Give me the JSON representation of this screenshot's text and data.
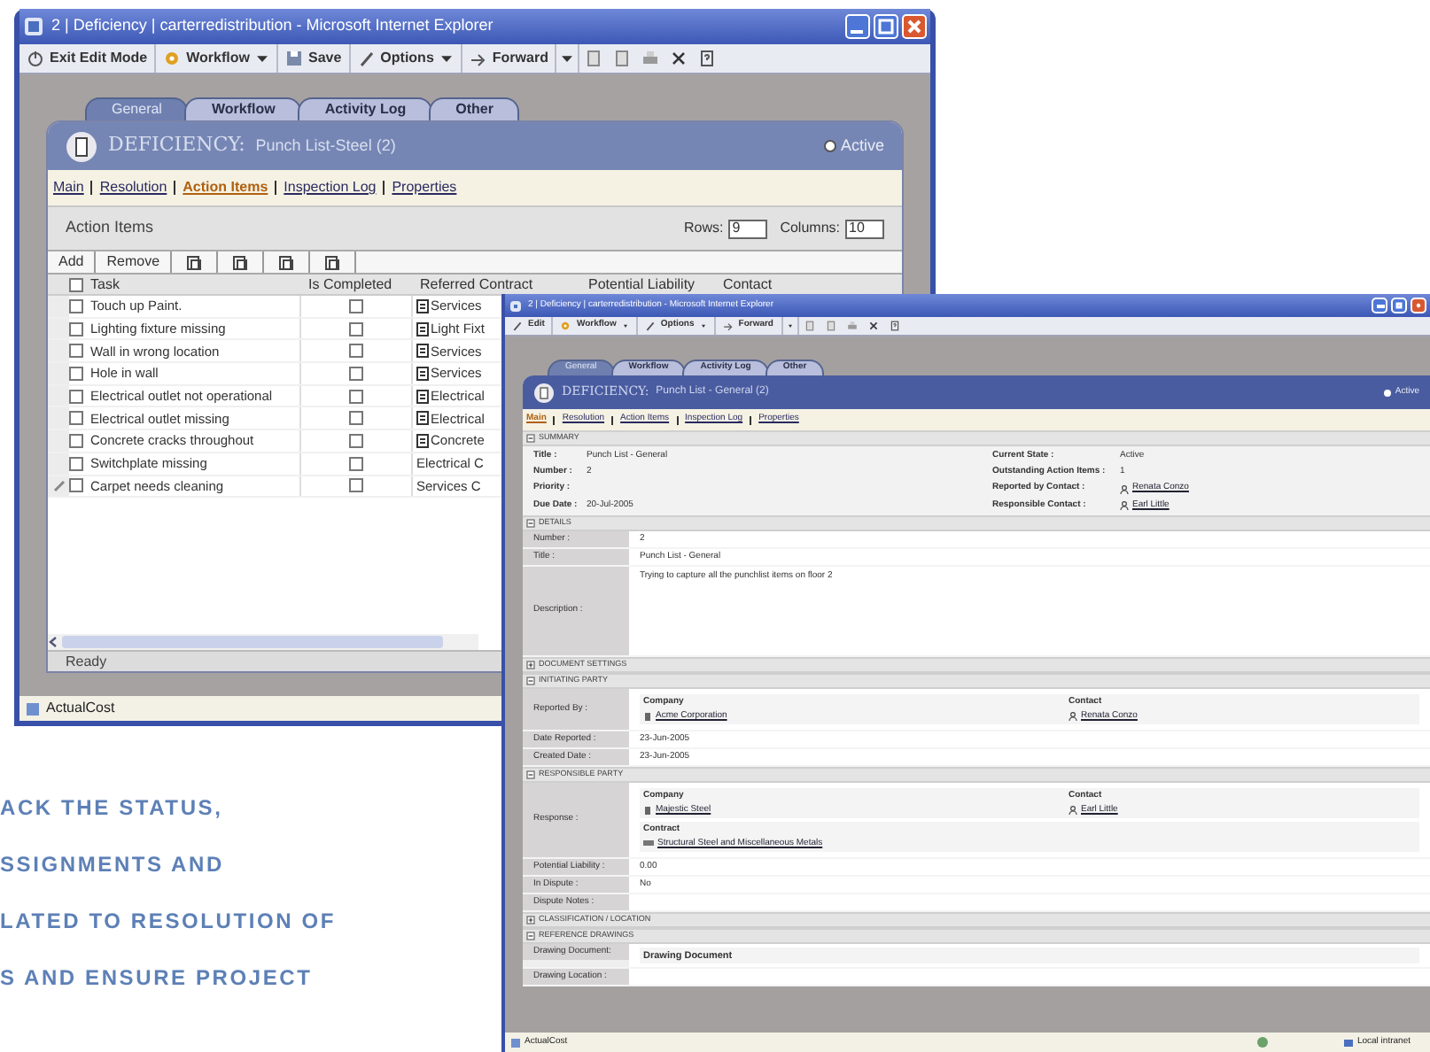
{
  "back_window": {
    "title": "2 | Deficiency | carterredistribution - Microsoft Internet Explorer",
    "toolbar": [
      {
        "label": "Exit Edit Mode",
        "kind": "button"
      },
      {
        "label": "Workflow",
        "kind": "menu"
      },
      {
        "label": "Save",
        "kind": "button"
      },
      {
        "label": "Options",
        "kind": "menu"
      },
      {
        "label": "Forward",
        "kind": "split"
      }
    ],
    "tabs": [
      {
        "label": "General",
        "selected": true
      },
      {
        "label": "Workflow",
        "selected": false
      },
      {
        "label": "Activity Log",
        "selected": false
      },
      {
        "label": "Other",
        "selected": false
      }
    ],
    "header": {
      "type_label": "DEFICIENCY:",
      "name": "Punch List-Steel (2)",
      "state": "Active"
    },
    "subnav": [
      {
        "label": "Main",
        "selected": false
      },
      {
        "label": "Resolution",
        "selected": false
      },
      {
        "label": "Action Items",
        "selected": true
      },
      {
        "label": "Inspection Log",
        "selected": false
      },
      {
        "label": "Properties",
        "selected": false
      }
    ],
    "panel_title": "Action Items",
    "rows_label": "Rows:",
    "rows_value": "9",
    "columns_label": "Columns:",
    "columns_value": "10",
    "grid_buttons": [
      "Add",
      "Remove"
    ],
    "select_all_checked": false,
    "columns": [
      "Task",
      "Is Completed",
      "Referred Contract",
      "Potential Liability",
      "Contact"
    ],
    "rows": [
      {
        "task": "Touch up Paint.",
        "selected": false,
        "completed": false,
        "contract": "Services",
        "document_icon": true,
        "editing": false
      },
      {
        "task": "Lighting fixture missing",
        "selected": false,
        "completed": false,
        "contract": "Light Fixt",
        "document_icon": true,
        "editing": false
      },
      {
        "task": "Wall in wrong location",
        "selected": false,
        "completed": false,
        "contract": "Services",
        "document_icon": true,
        "editing": false
      },
      {
        "task": "Hole in wall",
        "selected": false,
        "completed": false,
        "contract": "Services",
        "document_icon": true,
        "editing": false
      },
      {
        "task": "Electrical outlet not operational",
        "selected": false,
        "completed": false,
        "contract": "Electrical",
        "document_icon": true,
        "editing": false
      },
      {
        "task": "Electrical outlet missing",
        "selected": false,
        "completed": false,
        "contract": "Electrical",
        "document_icon": true,
        "editing": false
      },
      {
        "task": "Concrete cracks throughout",
        "selected": false,
        "completed": false,
        "contract": "Concrete",
        "document_icon": true,
        "editing": false
      },
      {
        "task": "Switchplate missing",
        "selected": false,
        "completed": false,
        "contract": "Electrical C",
        "document_icon": false,
        "editing": false
      },
      {
        "task": "Carpet needs cleaning",
        "selected": false,
        "completed": false,
        "contract": "Services C",
        "document_icon": false,
        "editing": true
      }
    ],
    "grid_status": "Ready",
    "status_bar": "ActualCost"
  },
  "front_window": {
    "title": "2 | Deficiency | carterredistribution - Microsoft Internet Explorer",
    "toolbar": [
      {
        "label": "Edit",
        "kind": "button"
      },
      {
        "label": "Workflow",
        "kind": "menu"
      },
      {
        "label": "Options",
        "kind": "menu"
      },
      {
        "label": "Forward",
        "kind": "split"
      }
    ],
    "tabs": [
      {
        "label": "General",
        "selected": true
      },
      {
        "label": "Workflow",
        "selected": false
      },
      {
        "label": "Activity Log",
        "selected": false
      },
      {
        "label": "Other",
        "selected": false
      }
    ],
    "header": {
      "type_label": "DEFICIENCY:",
      "name": "Punch List - General (2)",
      "state": "Active"
    },
    "subnav": [
      {
        "label": "Main",
        "selected": true
      },
      {
        "label": "Resolution",
        "selected": false
      },
      {
        "label": "Action Items",
        "selected": false
      },
      {
        "label": "Inspection Log",
        "selected": false
      },
      {
        "label": "Properties",
        "selected": false
      }
    ],
    "sections": [
      {
        "title": "SUMMARY",
        "expanded": true,
        "kind": "summary",
        "left": [
          {
            "label": "Title :",
            "value": "Punch List - General"
          },
          {
            "label": "Number :",
            "value": "2"
          },
          {
            "label": "Priority :"
          },
          {
            "label": "Due Date :",
            "value": "20-Jul-2005"
          }
        ],
        "right": [
          {
            "label": "Current State :",
            "value": "Active",
            "kind": "text"
          },
          {
            "label": "Outstanding Action Items :",
            "value": "1",
            "kind": "text"
          },
          {
            "label": "Reported by Contact :",
            "value": "Renata Conzo",
            "kind": "contact"
          },
          {
            "label": "Responsible Contact :",
            "value": "Earl Little",
            "kind": "contact"
          }
        ]
      },
      {
        "title": "DETAILS",
        "expanded": true,
        "kind": "fields",
        "fields": [
          {
            "label": "Number :",
            "value": "2",
            "kind": "text"
          },
          {
            "label": "Title :",
            "value": "Punch List - General",
            "kind": "text"
          },
          {
            "label": "Description :",
            "value": "Trying to capture all the punchlist items on floor 2",
            "kind": "tall"
          }
        ]
      },
      {
        "title": "DOCUMENT SETTINGS",
        "expanded": false
      },
      {
        "title": "INITIATING PARTY",
        "expanded": true,
        "kind": "fields",
        "fields": [
          {
            "label": "Reported By :",
            "kind": "party",
            "company_heading": "Company",
            "company": "Acme Corporation",
            "contact_heading": "Contact",
            "contact": "Renata Conzo"
          },
          {
            "label": "Date Reported :",
            "value": "23-Jun-2005",
            "kind": "text"
          },
          {
            "label": "Created Date :",
            "value": "23-Jun-2005",
            "kind": "text"
          }
        ]
      },
      {
        "title": "RESPONSIBLE PARTY",
        "expanded": true,
        "kind": "fields",
        "fields": [
          {
            "label": "Response :",
            "kind": "party",
            "company_heading": "Company",
            "company": "Majestic Steel",
            "contact_heading": "Contact",
            "contact": "Earl Little",
            "contract_heading": "Contract",
            "contract": "Structural Steel and Miscellaneous Metals"
          },
          {
            "label": "Potential Liability :",
            "value": "0.00",
            "kind": "text"
          },
          {
            "label": "In Dispute :",
            "value": "No",
            "kind": "text"
          },
          {
            "label": "Dispute Notes :",
            "kind": "text"
          }
        ]
      },
      {
        "title": "CLASSIFICATION / LOCATION",
        "expanded": false
      },
      {
        "title": "REFERENCE DRAWINGS",
        "expanded": true,
        "kind": "fields",
        "fields": [
          {
            "label": "Drawing Document:",
            "value": "Drawing Document",
            "kind": "boxed"
          },
          {
            "label": "Drawing Location :",
            "kind": "text"
          }
        ]
      }
    ],
    "status_bar": "ActualCost",
    "zone": "Local intranet"
  },
  "caption_lines": [
    "ACK THE STATUS,",
    "SSIGNMENTS AND",
    "LATED TO RESOLUTION OF",
    "S AND ENSURE PROJECT"
  ]
}
